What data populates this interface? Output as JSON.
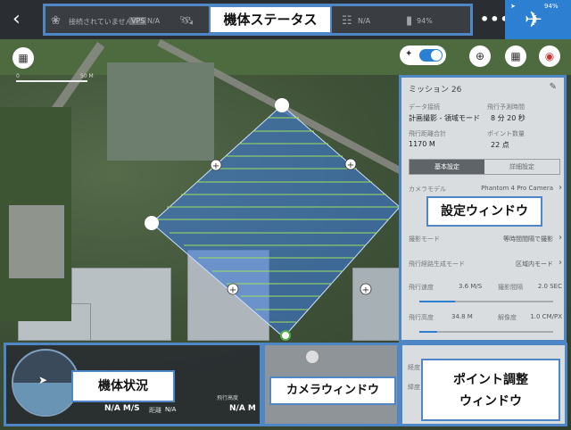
{
  "topbar": {
    "back_icon": "chevron-left-icon",
    "gps_status": "接続されていません",
    "vps_label": "VPS",
    "vps_value": "N/A",
    "rc_value": "N/A",
    "battery_value": "94%",
    "more_label": "•••",
    "fly_battery": "94%"
  },
  "map": {
    "scale_left": "0",
    "scale_right": "50 M"
  },
  "annotations": {
    "status": "機体ステータス",
    "settings": "設定ウィンドウ",
    "aircraft": "機体状況",
    "camera": "カメラウィンドウ",
    "point_adjust": "ポイント調整\nウィンドウ"
  },
  "panel": {
    "title": "ミッション 26",
    "edit_icon": "pencil-icon",
    "data_source_label": "データ接続",
    "data_source_value": "計画撮影 - 領域モード",
    "est_time_label": "飛行予測時間",
    "est_time_value": "8 分 20 秒",
    "distance_label": "飛行距離合計",
    "distance_value": "1170 M",
    "points_label": "ポイント数量",
    "points_value": "22 点",
    "tab_basic": "基本設定",
    "tab_detail": "詳細設定",
    "camera_label": "カメラモデル",
    "camera_value": "Phantom 4 Pro Camera",
    "shoot_mode_label": "撮影モード",
    "shoot_mode_value": "等時間間隔で撮影",
    "route_label": "飛行経路生成モード",
    "route_value": "区域内モード",
    "speed_label": "飛行速度",
    "speed_value": "3.6 M/S",
    "interval_label": "撮影間隔",
    "interval_value": "2.0 SEC",
    "altitude_label": "飛行高度",
    "altitude_value": "34.8 M",
    "gsd_label": "解像度",
    "gsd_value": "1.0 CM/PX"
  },
  "bottom": {
    "speed_value": "N/A M/S",
    "distance_label": "距離",
    "distance_value": "N/A",
    "height_label": "飛行高度",
    "height_value": "N/A M",
    "point_panel_label1": "経度",
    "point_panel_label2": "緯度"
  },
  "colors": {
    "accent": "#2d7fd1",
    "annotation_border": "#4f86c6",
    "area_fill": "#3d7ad6",
    "route_line": "#9ee05c"
  }
}
